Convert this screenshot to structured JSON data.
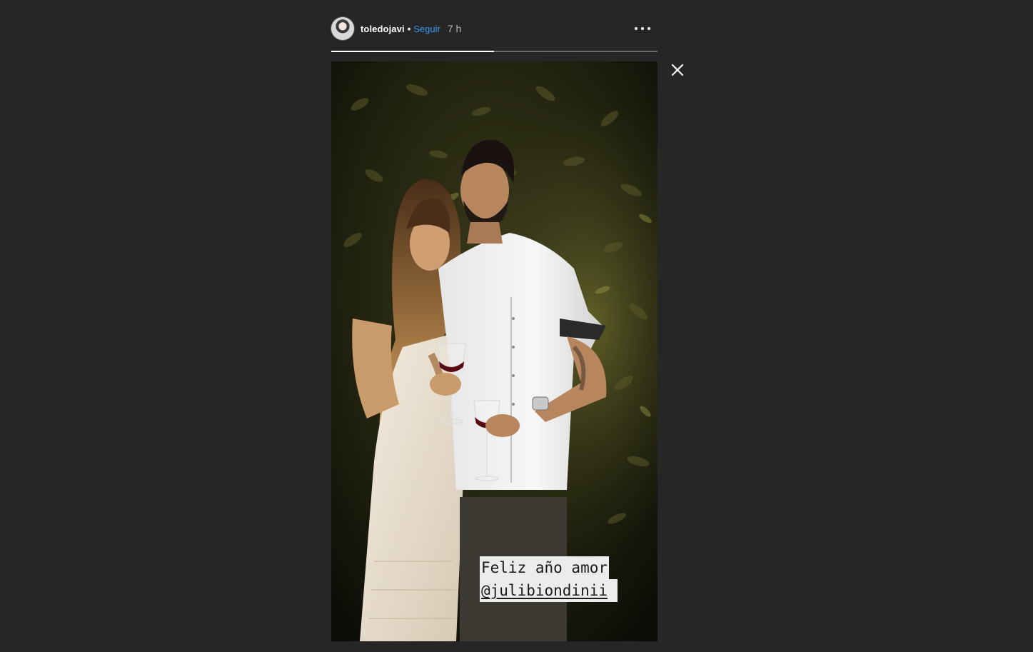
{
  "header": {
    "username": "toledojavi",
    "separator": "•",
    "follow_label": "Seguir",
    "time_ago": "7 h",
    "more_icon": "more-options-icon"
  },
  "progress": {
    "segments": [
      {
        "fill_fraction": 1.0
      },
      {
        "fill_fraction": 0.0
      }
    ]
  },
  "close_icon": "close-icon",
  "caption": {
    "line1": "Feliz año amor",
    "line2": "@julibiondinii"
  },
  "colors": {
    "background": "#262626",
    "accent_link": "#3897f0",
    "caption_bg": "#ececec"
  }
}
